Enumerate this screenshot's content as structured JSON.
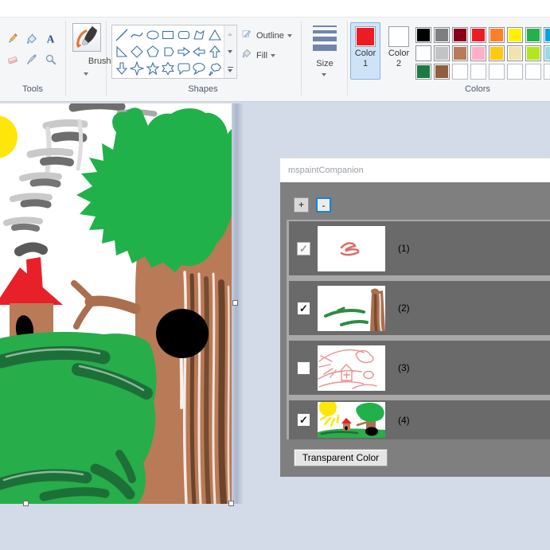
{
  "ribbon": {
    "tools": {
      "label": "Tools",
      "items": [
        "pencil",
        "fill-bucket",
        "text",
        "eraser",
        "eyedropper",
        "magnifier"
      ]
    },
    "brushes": {
      "label": "Brushes"
    },
    "shapes": {
      "label": "Shapes",
      "outline_label": "Outline",
      "fill_label": "Fill",
      "items": [
        "line",
        "curve",
        "ellipse",
        "rectangle",
        "rounded-rectangle",
        "polygon",
        "triangle",
        "right-triangle",
        "diamond",
        "pentagon",
        "hexagon",
        "arrow-right",
        "arrow-left",
        "arrow-up",
        "arrow-down",
        "star-4",
        "star-5",
        "star-6",
        "callout-rounded",
        "callout-oval",
        "callout-cloud"
      ]
    },
    "size": {
      "label": "Size"
    },
    "colors": {
      "label": "Colors",
      "color1": {
        "label_top": "Color",
        "label_bottom": "1",
        "value": "#ed1c24",
        "selected": true
      },
      "color2": {
        "label_top": "Color",
        "label_bottom": "2",
        "value": "#ffffff",
        "selected": false
      },
      "palette": [
        [
          "#000000",
          "#7f7f7f",
          "#880015",
          "#ed1c24",
          "#ff7f27",
          "#fff200",
          "#22b14c",
          "#00a2e8"
        ],
        [
          "#ffffff",
          "#c3c3c3",
          "#b97a57",
          "#ffaec9",
          "#ffc90e",
          "#efe4b0",
          "#b5e61d",
          "#99d9ea"
        ],
        [
          "#1d7a3e",
          "#8f5f3f",
          null,
          null,
          null,
          null,
          null,
          null
        ]
      ]
    }
  },
  "companion": {
    "title": "mspaintCompanion",
    "add_label": "+",
    "remove_label": "-",
    "layers": [
      {
        "label": "(1)",
        "checked": true,
        "disabled": true
      },
      {
        "label": "(2)",
        "checked": true,
        "disabled": false
      },
      {
        "label": "(3)",
        "checked": false,
        "disabled": false
      },
      {
        "label": "(4)",
        "checked": true,
        "disabled": false
      }
    ],
    "transparent_label": "Transparent Color"
  },
  "canvas_colors": {
    "sun": "#ffe60a",
    "sky_scribble_light": "#c9c9c9",
    "sky_scribble_dark": "#6e6e6e",
    "foliage": "#21b14b",
    "trunk": "#b97a57",
    "trunk_dark": "#6b432a",
    "grass": "#27ad4a",
    "grass_dark": "#1d6f38",
    "roof": "#e8202a",
    "door": "#000000"
  }
}
